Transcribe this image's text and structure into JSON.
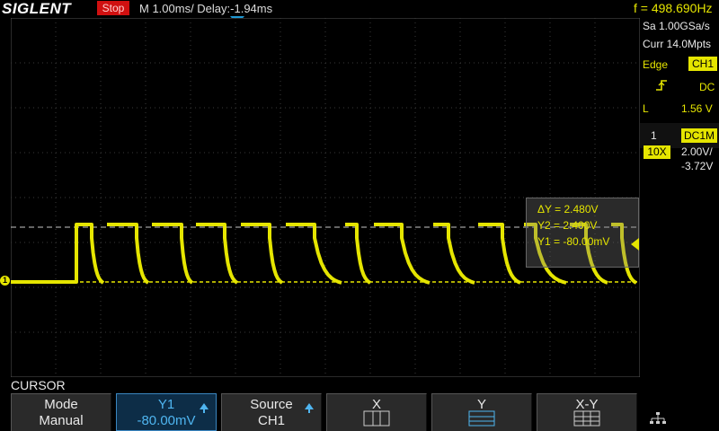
{
  "header": {
    "brand": "SIGLENT",
    "run_state": "Stop",
    "timebase": "M 1.00ms/ Delay:-1.94ms",
    "frequency": "f = 498.690Hz"
  },
  "acquisition": {
    "sample_rate": "Sa 1.00GSa/s",
    "memory": "Curr 14.0Mpts"
  },
  "trigger": {
    "type": "Edge",
    "source": "CH1",
    "slope_icon": "rising-edge-icon",
    "coupling": "DC",
    "level_label": "L",
    "level": "1.56 V"
  },
  "channel": {
    "number": "1",
    "name": "DC1M",
    "probe": "10X",
    "scale": "2.00V/",
    "offset": "-3.72V"
  },
  "cursor_readout": {
    "delta_y": "ΔY = 2.480V",
    "y2": "Y2 = 2.400V",
    "y1": "Y1 = -80.00mV"
  },
  "markers": {
    "ch1": "1"
  },
  "menu": {
    "title": "CURSOR",
    "buttons": [
      {
        "l1": "Mode",
        "l2": "Manual"
      },
      {
        "l1": "Y1",
        "l2": "-80.00mV"
      },
      {
        "l1": "Source",
        "l2": "CH1"
      },
      {
        "l1": "X",
        "icon": "x-cursor-icon"
      },
      {
        "l1": "Y",
        "icon": "y-cursor-icon"
      },
      {
        "l1": "X-Y",
        "icon": "xy-cursor-icon"
      }
    ],
    "network_icon": "network-icon"
  },
  "colors": {
    "trace": "#e5e500",
    "accent": "#4fb5f0",
    "stop": "#d01010",
    "trigger_marker": "#1e9ad6"
  }
}
